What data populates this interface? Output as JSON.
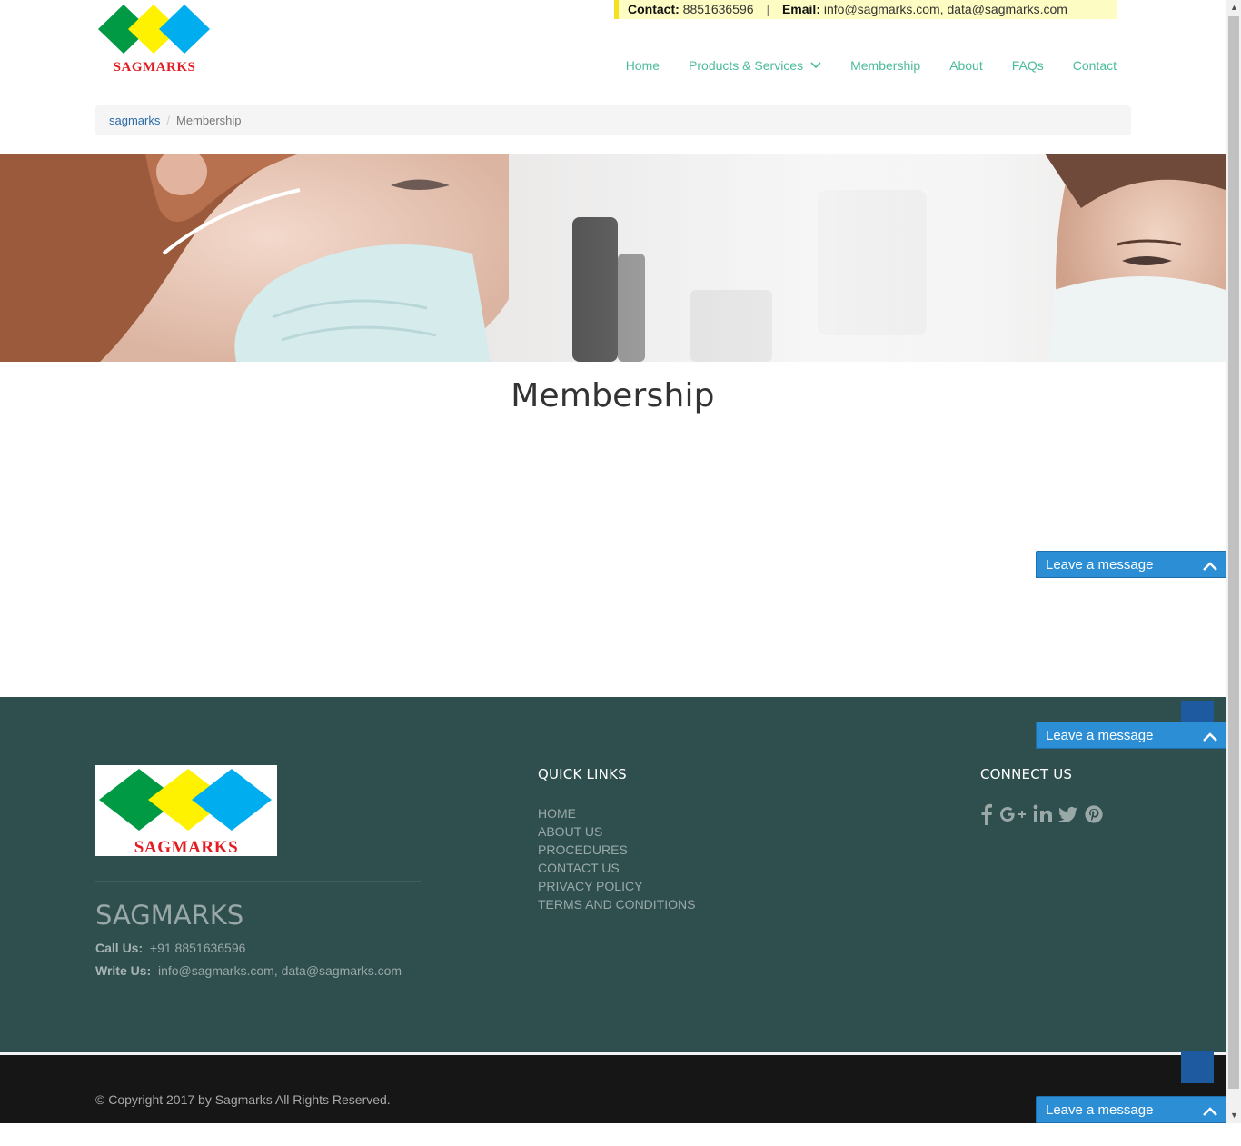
{
  "header": {
    "logo_text": "SAGMARKS",
    "contact_label": "Contact:",
    "contact_phone": "8851636596",
    "separator": "|",
    "email_label": "Email:",
    "email_value": "info@sagmarks.com, data@sagmarks.com"
  },
  "nav": {
    "items": [
      {
        "label": "Home"
      },
      {
        "label": "Products & Services"
      },
      {
        "label": "Membership"
      },
      {
        "label": "About"
      },
      {
        "label": "FAQs"
      },
      {
        "label": "Contact"
      }
    ]
  },
  "breadcrumb": {
    "home": "sagmarks",
    "divider": "/",
    "current": "Membership"
  },
  "page": {
    "title": "Membership"
  },
  "chat": {
    "label": "Leave a message"
  },
  "footer": {
    "logo_text": "SAGMARKS",
    "brand": "SAGMARKS",
    "call_label": "Call Us:",
    "call_value": "+91 8851636596",
    "write_label": "Write Us:",
    "write_value": "info@sagmarks.com, data@sagmarks.com",
    "quick_links_title": "QUICK LINKS",
    "quick_links": [
      "HOME",
      "ABOUT US",
      "PROCEDURES",
      "CONTACT US",
      "PRIVACY POLICY",
      "TERMS AND CONDITIONS"
    ],
    "connect_title": "CONNECT US",
    "social_icons": [
      "facebook-icon",
      "google-plus-icon",
      "linkedin-icon",
      "twitter-icon",
      "pinterest-icon"
    ],
    "copyright": "© Copyright 2017 by Sagmarks All Rights Reserved."
  },
  "colors": {
    "nav_link": "#4cbb9b",
    "footer_bg": "#2f4f4f",
    "chat_bg": "#2c8fd6",
    "contact_bar_bg": "#fdfcc2",
    "logo_green": "#009a44",
    "logo_yellow": "#fff200",
    "logo_blue": "#00aeef",
    "logo_red": "#e21d24"
  }
}
